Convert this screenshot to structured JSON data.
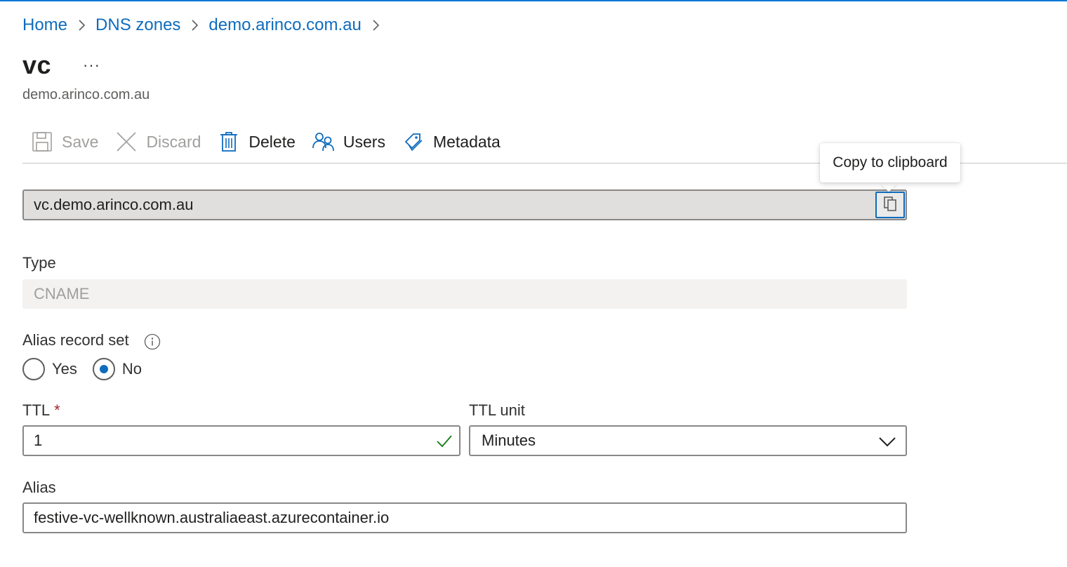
{
  "breadcrumb": {
    "items": [
      "Home",
      "DNS zones",
      "demo.arinco.com.au"
    ]
  },
  "header": {
    "title": "vc",
    "more_label": "···",
    "subtitle": "demo.arinco.com.au"
  },
  "toolbar": {
    "save_label": "Save",
    "discard_label": "Discard",
    "delete_label": "Delete",
    "users_label": "Users",
    "metadata_label": "Metadata"
  },
  "tooltip": {
    "text": "Copy to clipboard"
  },
  "fqdn": {
    "value": "vc.demo.arinco.com.au"
  },
  "type": {
    "label": "Type",
    "value": "CNAME"
  },
  "alias_record_set": {
    "label": "Alias record set",
    "options": [
      "Yes",
      "No"
    ],
    "selected": "No"
  },
  "ttl": {
    "label": "TTL",
    "required_mark": "*",
    "value": "1"
  },
  "ttl_unit": {
    "label": "TTL unit",
    "value": "Minutes"
  },
  "alias": {
    "label": "Alias",
    "value": "festive-vc-wellknown.australiaeast.azurecontainer.io"
  },
  "colors": {
    "link": "#0f6cbd",
    "accent": "#0078d4",
    "valid": "#107c10",
    "required": "#a4262c"
  }
}
